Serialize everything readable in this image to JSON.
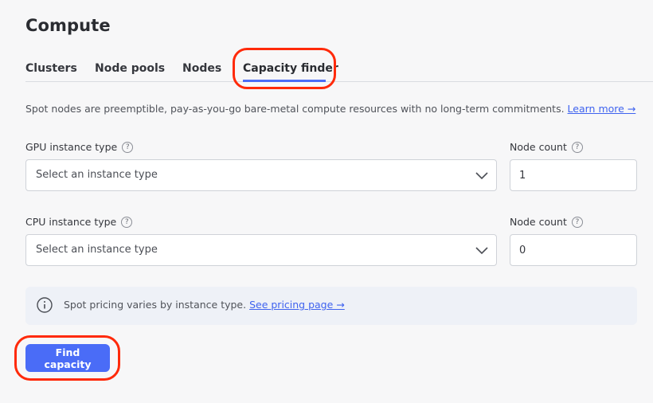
{
  "page": {
    "title": "Compute"
  },
  "tabs": [
    {
      "label": "Clusters",
      "active": false
    },
    {
      "label": "Node pools",
      "active": false
    },
    {
      "label": "Nodes",
      "active": false
    },
    {
      "label": "Capacity finder",
      "active": true
    }
  ],
  "intro": {
    "text": "Spot nodes are preemptible, pay-as-you-go bare-metal compute resources with no long-term commitments.",
    "link_label": "Learn more →"
  },
  "gpu": {
    "label": "GPU instance type",
    "placeholder": "Select an instance type",
    "count_label": "Node count",
    "count_value": "1"
  },
  "cpu": {
    "label": "CPU instance type",
    "placeholder": "Select an instance type",
    "count_label": "Node count",
    "count_value": "0"
  },
  "banner": {
    "text": "Spot pricing varies by instance type.",
    "link_label": "See pricing page →"
  },
  "actions": {
    "find_label": "Find capacity"
  },
  "colors": {
    "accent": "#4a6cf7",
    "highlight": "#ff2a0a",
    "background": "#f7f7f8",
    "banner_bg": "#eef1f7"
  },
  "icons": {
    "help": "help-circle-icon",
    "chevron": "chevron-down-icon",
    "info": "info-circle-icon"
  }
}
